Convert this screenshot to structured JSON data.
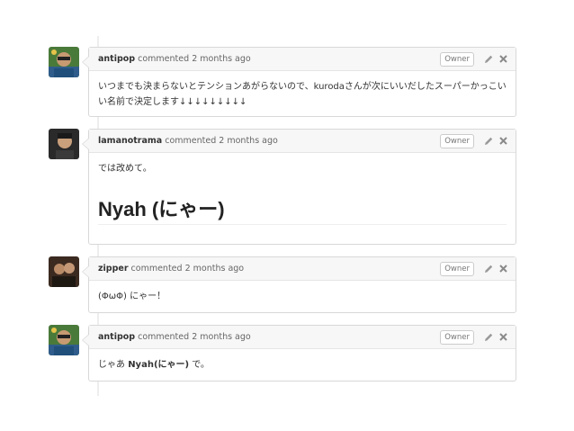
{
  "comments": [
    {
      "author": "antipop",
      "action": "commented",
      "time": "2 months ago",
      "badge": "Owner",
      "avatar": "avatar-antipop",
      "text": "いつまでも決まらないとテンションあがらないので、kurodaさんが次にいいだしたスーパーかっこいい名前で決定します↓↓↓↓↓↓↓↓↓"
    },
    {
      "author": "lamanotrama",
      "action": "commented",
      "time": "2 months ago",
      "badge": "Owner",
      "avatar": "avatar-lamanotrama",
      "text": "では改めて。",
      "heading": "Nyah (にゃー)"
    },
    {
      "author": "zipper",
      "action": "commented",
      "time": "2 months ago",
      "badge": "Owner",
      "avatar": "avatar-zipper",
      "text": "(ΦωΦ) にゃー！"
    },
    {
      "author": "antipop",
      "action": "commented",
      "time": "2 months ago",
      "badge": "Owner",
      "avatar": "avatar-antipop",
      "text_prefix": "じゃあ ",
      "text_bold": "Nyah(にゃー)",
      "text_suffix": " で。"
    }
  ],
  "icons": {
    "edit": "pencil-icon",
    "close": "close-icon"
  }
}
